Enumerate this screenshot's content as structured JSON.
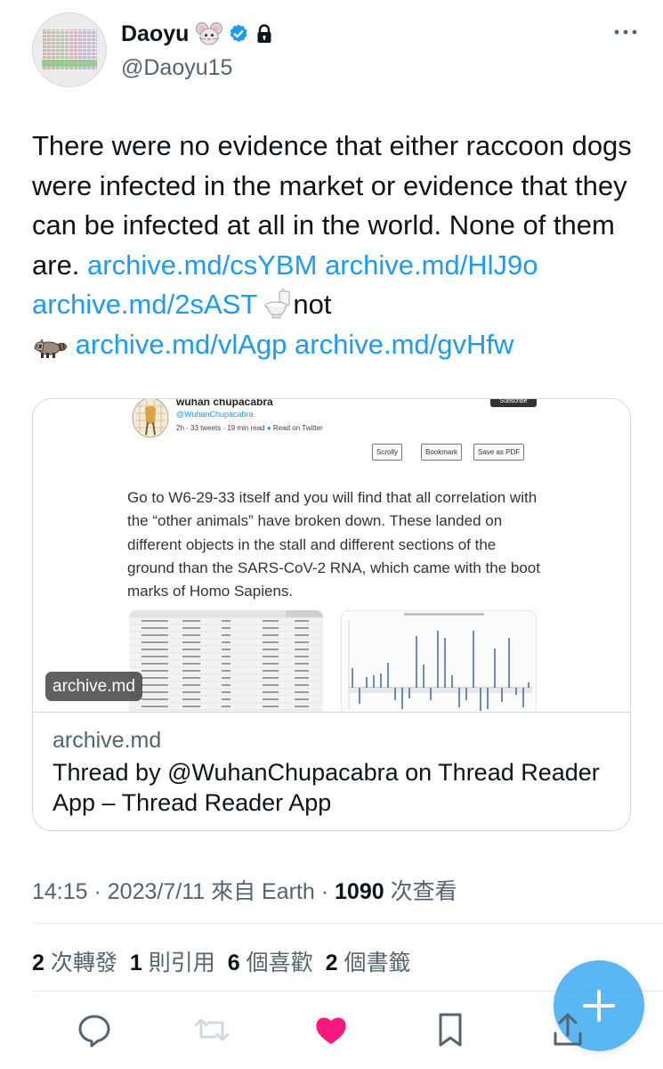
{
  "author": {
    "display_name": "Daoyu",
    "handle": "@Daoyu15",
    "name_emoji": "mouse-face-emoji",
    "verified_icon": "verified-badge-icon",
    "protected_icon": "lock-icon"
  },
  "tweet": {
    "text_1": "There were no evidence that either raccoon dogs were infected in the market or evidence that they can be infected at all in the world. None of them are. ",
    "link_1": "archive.md/csYBM",
    "link_2": "archive.md/HlJ9o",
    "link_3": "archive.md/2sAST",
    "toilet_emoji": "toilet-emoji",
    "text_2": "not",
    "raccoon_emoji": "raccoon-emoji",
    "link_4": "archive.md/vlAgp",
    "link_5": "archive.md/gvHfw"
  },
  "card": {
    "image_badge": "archive.md",
    "domain": "archive.md",
    "title": "Thread by @WuhanChupacabra on Thread Reader App – Thread Reader App",
    "preview": {
      "author_name": "wuhan chupacabra",
      "author_handle": "@WuhanChupacabra",
      "meta": "2h · 33 tweets · 19 min read",
      "read_on": "Read on Twitter",
      "subscribe": "Subscribe",
      "btn_scrolly": "Scrolly",
      "btn_bookmark": "Bookmark",
      "btn_pdf": "Save as PDF",
      "body": "Go to W6-29-33 itself and you will find that all correlation with the “other animals” have broken down. These landed on different objects in the stall and different sections of the ground than the SARS-CoV-2 RNA, which came with the boot marks of Homo Sapiens."
    }
  },
  "meta": {
    "time": "14:15 · 2023/7/11 來自 Earth · ",
    "views_count": "1090",
    "views_label": " 次查看"
  },
  "stats": {
    "retweets_count": "2",
    "retweets_label": " 次轉發",
    "quotes_count": "1",
    "quotes_label": "則引用",
    "likes_count": "6",
    "likes_label": " 個喜歡",
    "bookmarks_count": "2",
    "bookmarks_label": " 個書籤"
  },
  "colors": {
    "link": "#1d9bf0",
    "like_active": "#f91880",
    "secondary_text": "#536471",
    "fab": "#1d9bf0"
  },
  "icons": {
    "reply": "reply-icon",
    "retweet": "retweet-icon",
    "like": "heart-icon",
    "bookmark": "bookmark-icon",
    "share": "share-icon",
    "compose": "compose-plus-icon",
    "more": "more-options-icon"
  }
}
